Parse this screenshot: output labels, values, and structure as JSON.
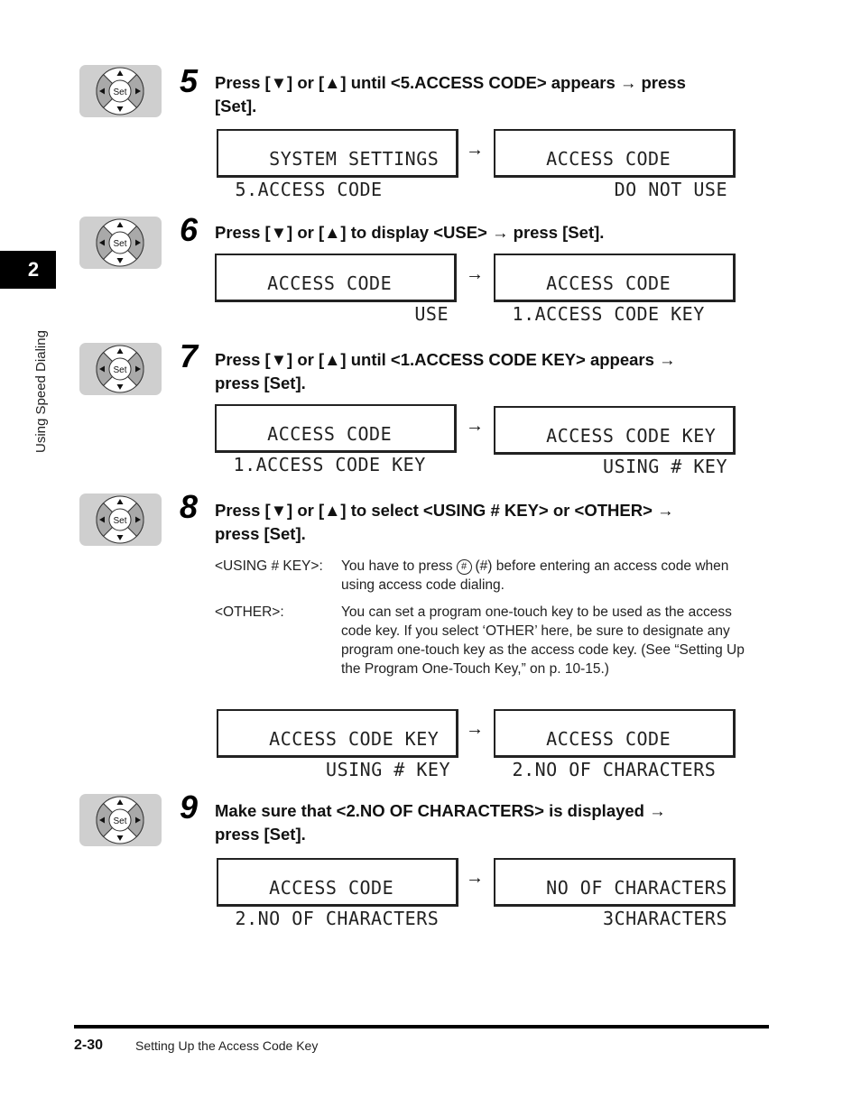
{
  "chapter": {
    "number": "2",
    "title": "Using Speed Dialing"
  },
  "icons": {
    "control_pad": "set-arrow-pad-icon",
    "pad_label": "Set",
    "arrow": "→"
  },
  "steps": [
    {
      "number": "5",
      "instruction_line1": "Press [▼] or [▲] until <5.ACCESS CODE> appears → press",
      "instruction_line2": "[Set].",
      "displays": [
        {
          "line1": "SYSTEM SETTINGS",
          "line2": " 5.ACCESS CODE",
          "align2": "left"
        },
        {
          "line1": "ACCESS CODE",
          "line2": "DO NOT USE",
          "align2": "right"
        }
      ]
    },
    {
      "number": "6",
      "instruction_line1": "Press [▼] or [▲] to display <USE> → press [Set].",
      "instruction_line2": "",
      "displays": [
        {
          "line1": "ACCESS CODE",
          "line2": "USE",
          "align2": "right"
        },
        {
          "line1": "ACCESS CODE",
          "line2": " 1.ACCESS CODE KEY",
          "align2": "left"
        }
      ]
    },
    {
      "number": "7",
      "instruction_line1": "Press [▼] or [▲] until <1.ACCESS CODE KEY> appears →",
      "instruction_line2": "press [Set].",
      "displays": [
        {
          "line1": "ACCESS CODE",
          "line2": " 1.ACCESS CODE KEY",
          "align2": "left"
        },
        {
          "line1": "ACCESS CODE KEY",
          "line2": "USING # KEY",
          "align2": "right"
        }
      ]
    },
    {
      "number": "8",
      "instruction_line1": "Press [▼] or [▲] to select <USING # KEY> or <OTHER> →",
      "instruction_line2": "press [Set].",
      "options": [
        {
          "term": "<USING # KEY>:",
          "def_before_key": "You have to press",
          "key_symbol": "#",
          "def_after_key": "(#) before entering an access code when using access code dialing."
        },
        {
          "term": "<OTHER>:",
          "def": "You can set a program one-touch key to be used as the access code key. If you select ‘OTHER’ here, be sure to designate any program one-touch key as the access code key. (See “Setting Up the Program One-Touch Key,” on p. 10-15.)"
        }
      ],
      "displays": [
        {
          "line1": "ACCESS CODE KEY",
          "line2": "USING # KEY",
          "align2": "right"
        },
        {
          "line1": "ACCESS CODE",
          "line2": " 2.NO OF CHARACTERS",
          "align2": "left"
        }
      ]
    },
    {
      "number": "9",
      "instruction_line1": "Make sure that <2.NO OF CHARACTERS> is displayed →",
      "instruction_line2": "press [Set].",
      "displays": [
        {
          "line1": "ACCESS CODE",
          "line2": " 2.NO OF CHARACTERS",
          "align2": "left"
        },
        {
          "line1": "NO OF CHARACTERS",
          "line2": "3CHARACTERS",
          "align2": "right"
        }
      ]
    }
  ],
  "footer": {
    "page_number": "2-30",
    "section_title": "Setting Up the Access Code Key"
  }
}
